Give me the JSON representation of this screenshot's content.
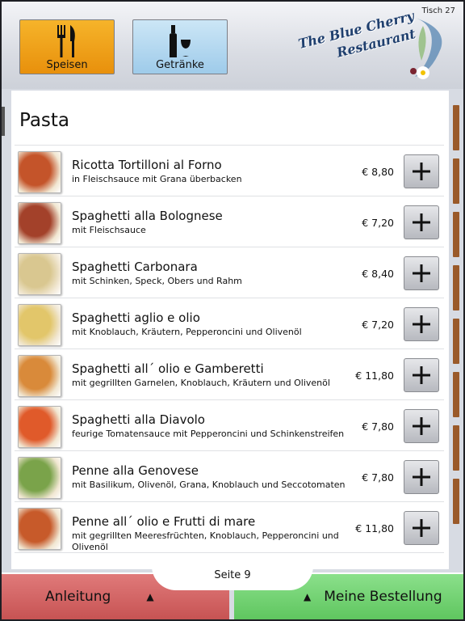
{
  "header": {
    "table_label": "Tisch 27",
    "tabs": [
      {
        "label": "Speisen",
        "icon": "cutlery-icon",
        "color": "#f0a01a"
      },
      {
        "label": "Getränke",
        "icon": "wine-icon",
        "color": "#b4d9f1"
      }
    ],
    "logo": {
      "line1": "The Blue Cherry",
      "line2": "Restaurant"
    }
  },
  "main": {
    "section_title": "Pasta",
    "items": [
      {
        "name": "Ricotta Tortilloni al Forno",
        "desc": "in Fleischsauce mit Grana überbacken",
        "price": "€ 8,80",
        "thumb_color": "#c4542a"
      },
      {
        "name": "Spaghetti alla Bolognese",
        "desc": "mit Fleischsauce",
        "price": "€ 7,20",
        "thumb_color": "#a3412a"
      },
      {
        "name": "Spaghetti Carbonara",
        "desc": "mit Schinken, Speck, Obers und Rahm",
        "price": "€ 8,40",
        "thumb_color": "#d9c790"
      },
      {
        "name": "Spaghetti aglio e olio",
        "desc": "mit Knoblauch, Kräutern, Pepperoncini und Olivenöl",
        "price": "€ 7,20",
        "thumb_color": "#e2c66a"
      },
      {
        "name": "Spaghetti all´ olio e Gamberetti",
        "desc": "mit gegrillten Garnelen, Knoblauch, Kräutern und Olivenöl",
        "price": "€ 11,80",
        "thumb_color": "#d98a3a"
      },
      {
        "name": "Spaghetti alla Diavolo",
        "desc": "feurige Tomatensauce mit Pepperoncini und Schinkenstreifen",
        "price": "€ 7,80",
        "thumb_color": "#e05a2a"
      },
      {
        "name": "Penne alla Genovese",
        "desc": "mit Basilikum, Olivenöl, Grana, Knoblauch und Seccotomaten",
        "price": "€ 7,80",
        "thumb_color": "#7aa34a"
      },
      {
        "name": "Penne all´ olio e Frutti di mare",
        "desc": "mit gegrillten Meeresfrüchten, Knoblauch, Pepperoncini und Olivenöl",
        "price": "€ 11,80",
        "thumb_color": "#c75a2a"
      }
    ]
  },
  "footer": {
    "page_label": "Seite 9",
    "help_label": "Anleitung",
    "order_label": "Meine Bestellung",
    "help_color": "#d46666",
    "order_color": "#77d477"
  }
}
